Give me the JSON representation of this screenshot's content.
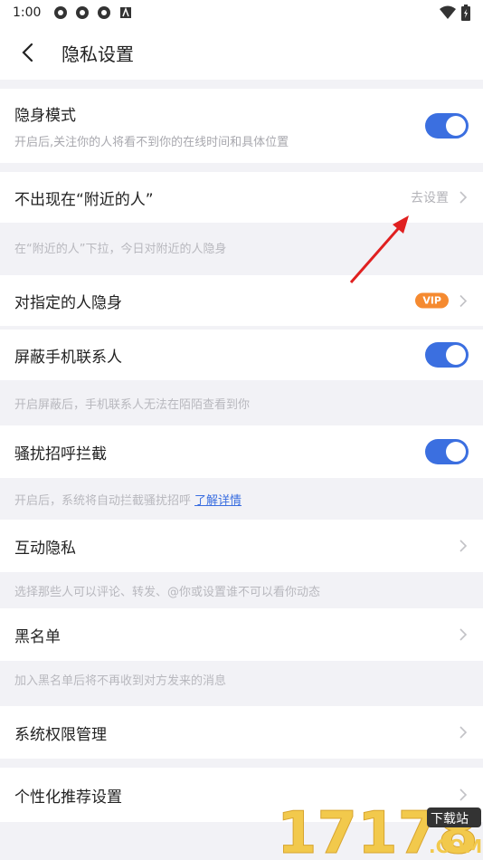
{
  "status_bar": {
    "time": "1:00"
  },
  "header": {
    "title": "隐私设置"
  },
  "stealth_mode": {
    "label": "隐身模式",
    "description": "开启后,关注你的人将看不到你的在线时间和具体位置",
    "enabled": true
  },
  "nearby": {
    "label": "不出现在“附近的人”",
    "action": "去设置",
    "hint": "在“附近的人”下拉，今日对附近的人隐身"
  },
  "specific_hide": {
    "label": "对指定的人隐身",
    "badge": "VIP"
  },
  "block_contacts": {
    "label": "屏蔽手机联系人",
    "enabled": true,
    "hint": "开启屏蔽后，手机联系人无法在陌陌查看到你"
  },
  "harass_block": {
    "label": "骚扰招呼拦截",
    "enabled": true,
    "hint": "开启后，系统将自动拦截骚扰招呼",
    "hint_link": "了解详情"
  },
  "interaction_privacy": {
    "label": "互动隐私",
    "hint": "选择那些人可以评论、转发、@你或设置谁不可以看你动态"
  },
  "blacklist": {
    "label": "黑名单",
    "hint": "加入黑名单后将不再收到对方发来的消息"
  },
  "system_permissions": {
    "label": "系统权限管理"
  },
  "personalized_recommend": {
    "label": "个性化推荐设置"
  },
  "watermark": {
    "text": "17178",
    "sub": "下载站",
    "domain": ".COM"
  },
  "colors": {
    "accent": "#3b6fe0",
    "vip": "#f58a30",
    "annotation": "#e02020"
  }
}
